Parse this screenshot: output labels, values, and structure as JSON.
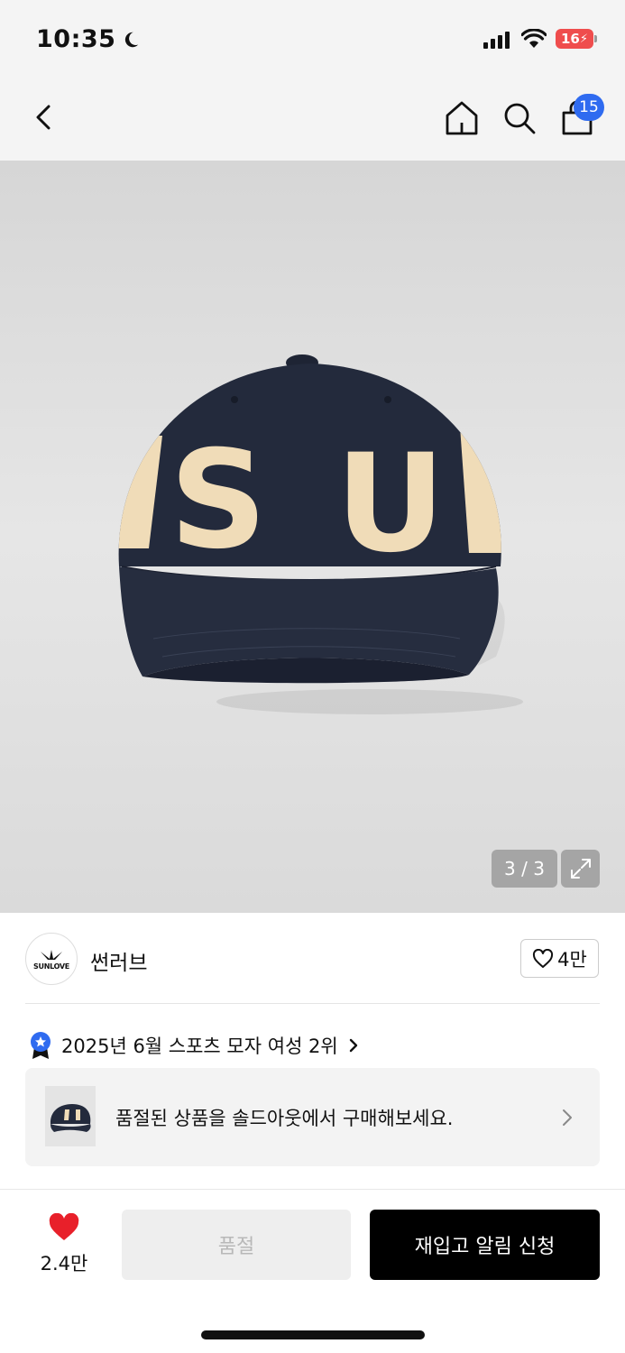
{
  "status_bar": {
    "time": "10:35",
    "battery": "16",
    "icons": [
      "moon-icon",
      "cellular-signal-icon",
      "wifi-icon",
      "battery-icon"
    ]
  },
  "nav": {
    "icons": [
      "back-icon",
      "home-icon",
      "search-icon",
      "shopping-bag-icon"
    ],
    "cart_count": "15"
  },
  "gallery": {
    "counter": "3 / 3",
    "expand_icon": "expand-icon",
    "cap_letters": [
      "S",
      "U"
    ],
    "cap_color": "#232a3c",
    "letter_color": "#f0dcb8"
  },
  "brand": {
    "logo_text": "SUNLOVE",
    "name": "썬러브",
    "follow_icon": "heart-outline-icon",
    "follow_count": "4만"
  },
  "ranking": {
    "text": "2025년 6월 스포츠 모자 여성 2위",
    "badge_icon": "ranking-badge-icon"
  },
  "soldout_promo": {
    "text": "품절된 상품을 솔드아웃에서 구매해보세요."
  },
  "bottom": {
    "like_count": "2.4만",
    "soldout_label": "품절",
    "restock_label": "재입고 알림 신청"
  },
  "colors": {
    "accent_blue": "#2f6bf0",
    "heart_red": "#e8202a",
    "battery_red": "#ef4d4d"
  }
}
